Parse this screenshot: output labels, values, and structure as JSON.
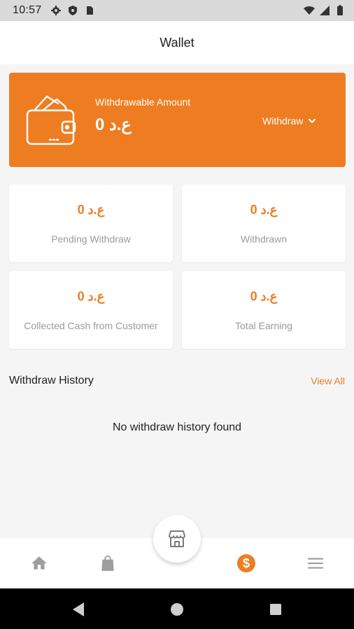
{
  "status_bar": {
    "time": "10:57",
    "icons": [
      "gear-icon",
      "shield-icon",
      "sim-card-icon",
      "wifi-icon",
      "signal-icon",
      "battery-icon"
    ]
  },
  "app_bar": {
    "title": "Wallet"
  },
  "wallet": {
    "label": "Withdrawable Amount",
    "amount": "ع.د 0",
    "withdraw_label": "Withdraw",
    "color": "#ee7d22"
  },
  "stats": [
    {
      "value": "ع.د 0",
      "label": "Pending Withdraw"
    },
    {
      "value": "ع.د 0",
      "label": "Withdrawn"
    },
    {
      "value": "ع.د 0",
      "label": "Collected Cash from Customer"
    },
    {
      "value": "ع.د 0",
      "label": "Total Earning"
    }
  ],
  "withdraw_history": {
    "title": "Withdraw History",
    "view_all": "View All",
    "empty_message": "No withdraw history found"
  },
  "bottom_nav": {
    "items": [
      "home-icon",
      "shopping-bag-icon",
      "store-icon",
      "dollar-icon",
      "menu-icon"
    ],
    "active": "dollar-icon",
    "active_color": "#ee7d22",
    "inactive_color": "#9e9e9e"
  },
  "system_nav": {
    "buttons": [
      "back-icon",
      "home-circle-icon",
      "recents-icon"
    ]
  }
}
